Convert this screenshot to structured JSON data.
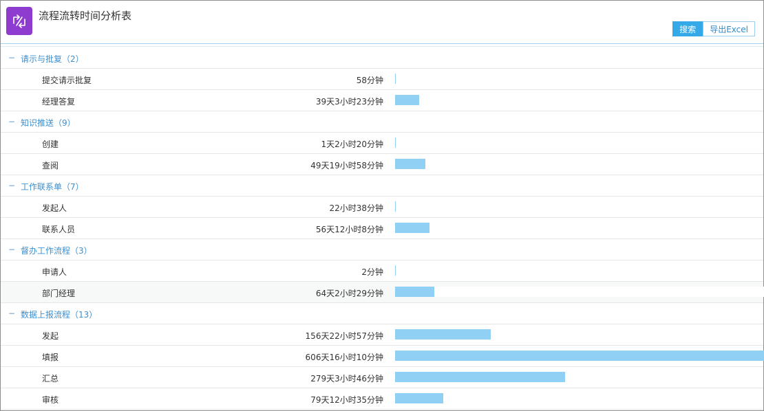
{
  "header": {
    "title": "流程流转时间分析表",
    "search_label": "搜索",
    "export_label": "导出Excel"
  },
  "colors": {
    "accent": "#35a9e7",
    "bar": "#8fd0f4",
    "group_text": "#3d8fcf",
    "app_icon": "#8e3bd0"
  },
  "icons": {
    "app": "refresh-arrows-icon",
    "collapse": "minus-icon"
  },
  "groups": [
    {
      "toggle": "−",
      "label": "请示与批复（2）",
      "items": [
        {
          "label": "提交请示批复",
          "time": "58分钟",
          "bar": 0.0001
        },
        {
          "label": "经理答复",
          "time": "39天3小时23分钟",
          "bar": 0.0646
        }
      ]
    },
    {
      "toggle": "−",
      "label": "知识推送（9）",
      "items": [
        {
          "label": "创建",
          "time": "1天2小时20分钟",
          "bar": 0.0018
        },
        {
          "label": "查阅",
          "time": "49天19小时58分钟",
          "bar": 0.0822
        }
      ]
    },
    {
      "toggle": "−",
      "label": "工作联系单（7）",
      "items": [
        {
          "label": "发起人",
          "time": "22小时38分钟",
          "bar": 0.0016
        },
        {
          "label": "联系人员",
          "time": "56天12小时8分钟",
          "bar": 0.0932
        }
      ]
    },
    {
      "toggle": "−",
      "label": "督办工作流程（3）",
      "items": [
        {
          "label": "申请人",
          "time": "2分钟",
          "bar": 0.0
        },
        {
          "label": "部门经理",
          "time": "64天2小时29分钟",
          "bar": 0.1057,
          "highlight": true
        }
      ]
    },
    {
      "toggle": "−",
      "label": "数据上报流程（13）",
      "items": [
        {
          "label": "发起",
          "time": "156天22小时57分钟",
          "bar": 0.2589
        },
        {
          "label": "填报",
          "time": "606天16小时10分钟",
          "bar": 1.0
        },
        {
          "label": "汇总",
          "time": "279天3小时46分钟",
          "bar": 0.4604
        },
        {
          "label": "审核",
          "time": "79天12小时35分钟",
          "bar": 0.1312
        }
      ]
    }
  ]
}
